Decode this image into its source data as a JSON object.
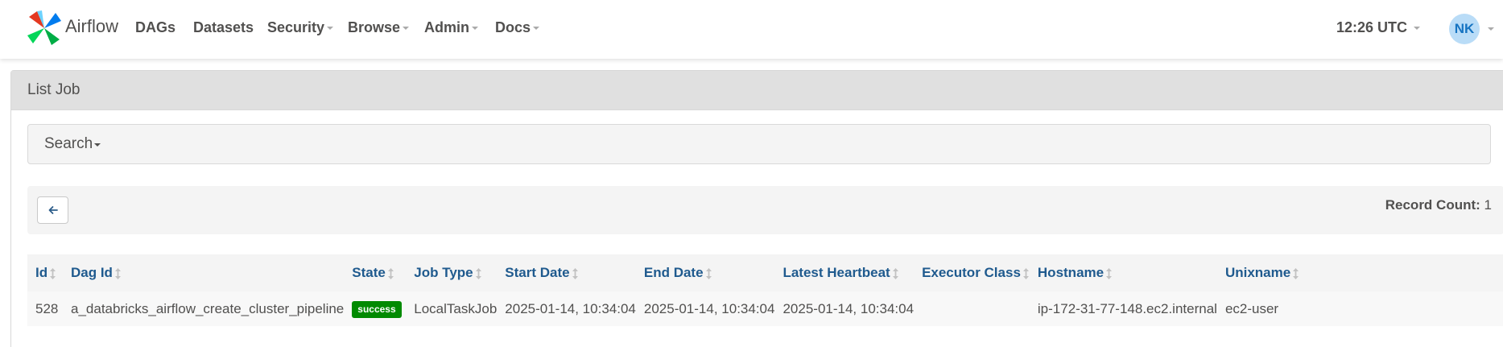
{
  "navbar": {
    "brand": "Airflow",
    "items": [
      {
        "label": "DAGs",
        "has_menu": false
      },
      {
        "label": "Datasets",
        "has_menu": false
      },
      {
        "label": "Security",
        "has_menu": true
      },
      {
        "label": "Browse",
        "has_menu": true
      },
      {
        "label": "Admin",
        "has_menu": true
      },
      {
        "label": "Docs",
        "has_menu": true
      }
    ],
    "clock": "12:26 UTC",
    "user_initials": "NK"
  },
  "panel": {
    "title": "List Job",
    "search_label": "Search",
    "record_count_label": "Record Count:",
    "record_count_value": "1"
  },
  "table": {
    "columns": [
      "Id",
      "Dag Id",
      "State",
      "Job Type",
      "Start Date",
      "End Date",
      "Latest Heartbeat",
      "Executor Class",
      "Hostname",
      "Unixname"
    ],
    "rows": [
      {
        "id": "528",
        "dag_id": "a_databricks_airflow_create_cluster_pipeline",
        "state": "success",
        "job_type": "LocalTaskJob",
        "start_date": "2025-01-14, 10:34:04",
        "end_date": "2025-01-14, 10:34:04",
        "latest_heartbeat": "2025-01-14, 10:34:04",
        "executor_class": "",
        "hostname": "ip-172-31-77-148.ec2.internal",
        "unixname": "ec2-user"
      }
    ]
  },
  "colors": {
    "link": "#1f5a8e",
    "success": "#018a01",
    "avatar_bg": "#b9dcf7",
    "avatar_text": "#1674c2"
  },
  "icons": {
    "logo": "airflow-pinwheel-logo",
    "back": "arrow-left-icon",
    "sort": "sort-updown-icon"
  }
}
